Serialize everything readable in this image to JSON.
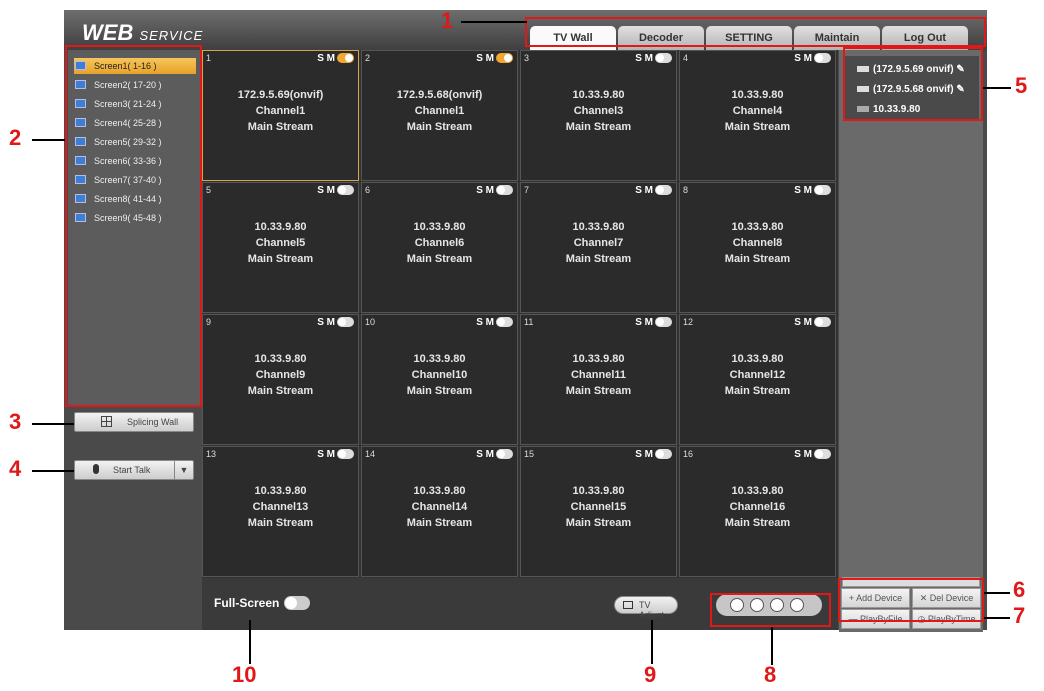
{
  "header": {
    "logo_main": "WEB",
    "logo_sub": "SERVICE"
  },
  "tabs": [
    {
      "label": "TV Wall"
    },
    {
      "label": "Decoder"
    },
    {
      "label": "SETTING"
    },
    {
      "label": "Maintain"
    },
    {
      "label": "Log Out"
    }
  ],
  "screens": [
    {
      "label": "Screen1( 1-16 )"
    },
    {
      "label": "Screen2( 17-20 )"
    },
    {
      "label": "Screen3( 21-24 )"
    },
    {
      "label": "Screen4( 25-28 )"
    },
    {
      "label": "Screen5( 29-32 )"
    },
    {
      "label": "Screen6( 33-36 )"
    },
    {
      "label": "Screen7( 37-40 )"
    },
    {
      "label": "Screen8( 41-44 )"
    },
    {
      "label": "Screen9( 45-48 )"
    }
  ],
  "buttons": {
    "splicing_wall": "Splicing Wall",
    "start_talk": "Start Talk",
    "full_screen": "Full-Screen",
    "tv_adjust": "TV Adjust",
    "add_device": "Add Device",
    "del_device": "Del Device",
    "play_by_file": "PlayByFile",
    "play_by_time": "PlayByTime"
  },
  "cell_controls": {
    "s_label": "S",
    "m_label": "M"
  },
  "cells": [
    {
      "num": "1",
      "ip": "172.9.5.69(onvif)",
      "channel": "Channel1",
      "stream": "Main Stream",
      "toggle_on": true
    },
    {
      "num": "2",
      "ip": "172.9.5.68(onvif)",
      "channel": "Channel1",
      "stream": "Main Stream",
      "toggle_on": true
    },
    {
      "num": "3",
      "ip": "10.33.9.80",
      "channel": "Channel3",
      "stream": "Main Stream",
      "toggle_on": false
    },
    {
      "num": "4",
      "ip": "10.33.9.80",
      "channel": "Channel4",
      "stream": "Main Stream",
      "toggle_on": false
    },
    {
      "num": "5",
      "ip": "10.33.9.80",
      "channel": "Channel5",
      "stream": "Main Stream",
      "toggle_on": false
    },
    {
      "num": "6",
      "ip": "10.33.9.80",
      "channel": "Channel6",
      "stream": "Main Stream",
      "toggle_on": false
    },
    {
      "num": "7",
      "ip": "10.33.9.80",
      "channel": "Channel7",
      "stream": "Main Stream",
      "toggle_on": false
    },
    {
      "num": "8",
      "ip": "10.33.9.80",
      "channel": "Channel8",
      "stream": "Main Stream",
      "toggle_on": false
    },
    {
      "num": "9",
      "ip": "10.33.9.80",
      "channel": "Channel9",
      "stream": "Main Stream",
      "toggle_on": false
    },
    {
      "num": "10",
      "ip": "10.33.9.80",
      "channel": "Channel10",
      "stream": "Main Stream",
      "toggle_on": false
    },
    {
      "num": "11",
      "ip": "10.33.9.80",
      "channel": "Channel11",
      "stream": "Main Stream",
      "toggle_on": false
    },
    {
      "num": "12",
      "ip": "10.33.9.80",
      "channel": "Channel12",
      "stream": "Main Stream",
      "toggle_on": false
    },
    {
      "num": "13",
      "ip": "10.33.9.80",
      "channel": "Channel13",
      "stream": "Main Stream",
      "toggle_on": false
    },
    {
      "num": "14",
      "ip": "10.33.9.80",
      "channel": "Channel14",
      "stream": "Main Stream",
      "toggle_on": false
    },
    {
      "num": "15",
      "ip": "10.33.9.80",
      "channel": "Channel15",
      "stream": "Main Stream",
      "toggle_on": false
    },
    {
      "num": "16",
      "ip": "10.33.9.80",
      "channel": "Channel16",
      "stream": "Main Stream",
      "toggle_on": false
    }
  ],
  "devices": [
    {
      "label": "(172.9.5.69 onvif)",
      "icon": "camera-icon"
    },
    {
      "label": "(172.9.5.68 onvif)",
      "icon": "camera-icon"
    },
    {
      "label": "10.33.9.80",
      "icon": "dvr-icon"
    }
  ],
  "callouts": [
    "1",
    "2",
    "3",
    "4",
    "5",
    "6",
    "7",
    "8",
    "9",
    "10"
  ],
  "colors": {
    "accent": "#e01818",
    "selected": "#f0a830"
  }
}
